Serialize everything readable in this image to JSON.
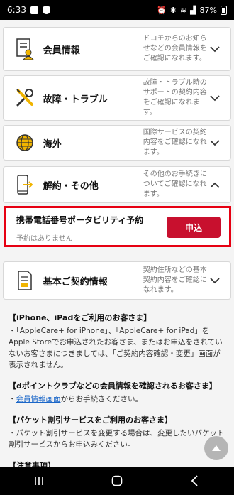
{
  "status_bar": {
    "time": "6:33",
    "battery": "87%"
  },
  "cards": [
    {
      "key": "member",
      "title": "会員情報",
      "desc": "ドコモからのお知らせなどの会員情報をご確認になれます。",
      "icon": "person-document-icon",
      "chevron": "down"
    },
    {
      "key": "trouble",
      "title": "故障・トラブル",
      "desc": "故障・トラブル時のサポートの契約内容をご確認になれます。",
      "icon": "tools-icon",
      "chevron": "down"
    },
    {
      "key": "overseas",
      "title": "海外",
      "desc": "国際サービスの契約内容をご確認になれます。",
      "icon": "globe-icon",
      "chevron": "down"
    },
    {
      "key": "cancel",
      "title": "解約・その他",
      "desc": "その他のお手続きについてご確認になれます。",
      "icon": "phone-arrow-icon",
      "chevron": "up"
    },
    {
      "key": "basic",
      "title": "基本ご契約情報",
      "desc": "契約住所などの基本契約内容をご確認になれます。",
      "icon": "document-icon",
      "chevron": "down"
    }
  ],
  "portability": {
    "title": "携帯電話番号ポータビリティ予約",
    "sub": "予約はありません",
    "button": "申込"
  },
  "notes": {
    "iphone_head": "【iPhone、iPadをご利用のお客さま】",
    "iphone_body": "・「AppleCare+ for iPhone」、「AppleCare+ for iPad」をApple Storeでお申込されたお客さま、またはお申込をされていないお客さまにつきましては、「ご契約内容確認・変更」画面が表示されません。",
    "dpoint_head": "【dポイントクラブなどの会員情報を確認されるお客さま】",
    "dpoint_link": "会員情報画面",
    "dpoint_rest": "からお手続きください。",
    "packet_head": "【パケット割引サービスをご利用のお客さま】",
    "packet_body": "・パケット割引サービスを変更する場合は、変更したいパケット割引サービスからお申込みください。",
    "caution_head": "【注意事項】"
  },
  "colors": {
    "accent": "#c8102e",
    "highlight_border": "#e60012",
    "link": "#1a66c8"
  }
}
